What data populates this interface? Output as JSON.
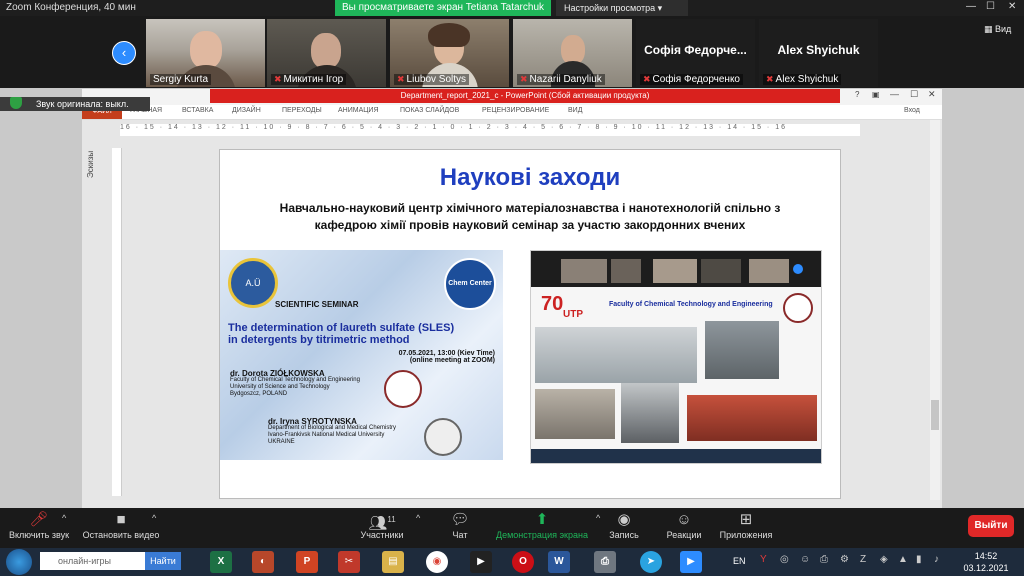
{
  "window": {
    "title": "Zoom Конференция, 40 мин",
    "share_banner": "Вы просматриваете экран Tetiana Tatarchuk",
    "view_options": "Настройки просмотра",
    "view_button": "Вид"
  },
  "participants": [
    {
      "name": "Sergiy Kurta",
      "muted": false,
      "has_video": true
    },
    {
      "name": "Микитин Ігор",
      "muted": true,
      "has_video": true
    },
    {
      "name": "Liubov Soltys",
      "muted": true,
      "has_video": true
    },
    {
      "name": "Nazarii Danyliuk",
      "muted": true,
      "has_video": true
    },
    {
      "name": "Софія Федорченко",
      "display": "Софія Федорче...",
      "muted": true,
      "has_video": false
    },
    {
      "name": "Alex Shyichuk",
      "display": "Alex Shyichuk",
      "muted": true,
      "has_video": false
    }
  ],
  "audio_label": "Звук оригинала: выкл.",
  "powerpoint": {
    "title": "Department_report_2021_c - PowerPoint (Сбой активации продукта)",
    "signin": "Вход",
    "tabs": [
      "ФАЙЛ",
      "ГЛАВНАЯ",
      "ВСТАВКА",
      "ДИЗАЙН",
      "ПЕРЕХОДЫ",
      "АНИМАЦИЯ",
      "ПОКАЗ СЛАЙДОВ",
      "РЕЦЕНЗИРОВАНИЕ",
      "ВИД"
    ],
    "ruler": "16 · 15 · 14 · 13 · 12 · 11 · 10 · 9 · 8 · 7 · 6 · 5 · 4 · 3 · 2 · 1 · 0 · 1 · 2 · 3 · 4 · 5 · 6 · 7 · 8 · 9 · 10 · 11 · 12 · 13 · 14 · 15 · 16",
    "thumbs_label": "Эскизы"
  },
  "slide": {
    "title": "Наукові заходи",
    "subtitle_line1": "Навчально-науковий центр хімічного матеріалознавства і нанотехнологій спільно з",
    "subtitle_line2": "кафедрою хімії провів науковий семінар за участю закордонних вчених",
    "poster": {
      "badge1": "A.Ü",
      "badge2": "Chem Center",
      "seminar": "SCIENTIFIC SEMINAR",
      "topic_line1": "The determination of laureth sulfate (SLES)",
      "topic_line2": "in detergents by titrimetric method",
      "datetime": "07.05.2021,  13:00 (Kiev Time)",
      "meeting": "(online meeting at ZOOM)",
      "speaker1": "dr. Dorota ZIÓŁKOWSKA",
      "speaker1_aff1": "Faculty of Chemical Technology and Engineering",
      "speaker1_aff2": "University of Science and Technology",
      "speaker1_aff3": "Bydgoszcz, POLAND",
      "speaker2": "dr. Iryna SYROTYNSKA",
      "speaker2_aff1": "Department of Biological and Medical Chemistry",
      "speaker2_aff2": "Ivano-Frankivsk National Medical University",
      "speaker2_aff3": "UKRAINE"
    },
    "screenshot": {
      "faculty": "Faculty of Chemical Technology and Engineering",
      "logo_text": "UTP",
      "anniversary": "70"
    }
  },
  "controls": {
    "mute": "Включить звук",
    "video": "Остановить видео",
    "participants": "Участники",
    "participants_count": "11",
    "chat": "Чат",
    "share": "Демонстрация экрана",
    "record": "Запись",
    "reactions": "Реакции",
    "apps": "Приложения",
    "exit": "Выйти"
  },
  "taskbar": {
    "search_placeholder": "онлайн-игры",
    "search_button": "Найти",
    "lang": "EN",
    "time": "14:52",
    "date": "03.12.2021"
  },
  "colors": {
    "zoom_green": "#1fb65a",
    "zoom_blue": "#2d8cff",
    "ppt_red": "#d9211e",
    "slide_title": "#1f3fbf",
    "exit_red": "#e02828"
  }
}
